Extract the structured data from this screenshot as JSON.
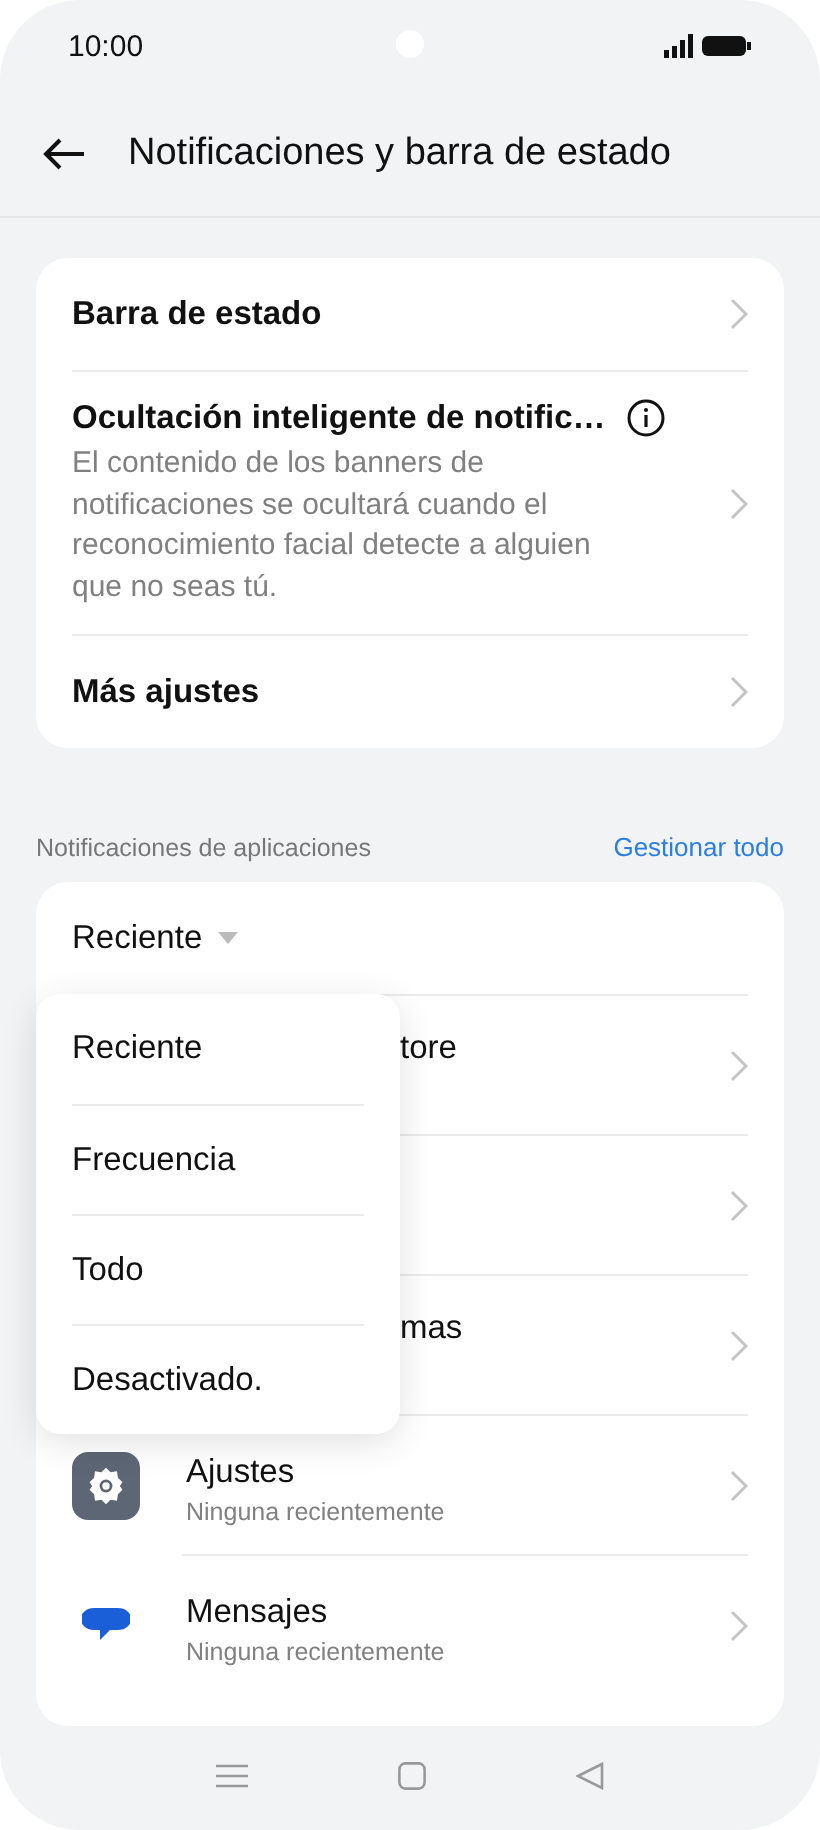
{
  "status_bar": {
    "time": "10:00"
  },
  "header": {
    "title": "Notificaciones y barra de estado"
  },
  "settings": [
    {
      "label": "Barra de estado"
    },
    {
      "label": "Ocultación inteligente de notific…",
      "description": "El contenido de los banners de notificaciones se ocultará cuando el reconocimiento facial detecte a alguien que no seas tú.",
      "info": true
    },
    {
      "label": "Más ajustes"
    }
  ],
  "app_notifications": {
    "section_title": "Notificaciones de aplicaciones",
    "action": "Gestionar todo",
    "sort": {
      "label": "Reciente",
      "expanded": true,
      "options": [
        {
          "label": "Reciente"
        },
        {
          "label": "Frecuencia"
        },
        {
          "label": "Todo"
        },
        {
          "label": "Desactivado."
        }
      ]
    },
    "apps": [
      {
        "kind": "covered",
        "name": "tore"
      },
      {
        "kind": "covered"
      },
      {
        "kind": "covered",
        "name": "mas"
      },
      {
        "kind": "app",
        "name": "Ajustes",
        "subtitle": "Ninguna recientemente"
      },
      {
        "kind": "app",
        "name": "Mensajes",
        "subtitle": "Ninguna recientemente"
      }
    ]
  }
}
